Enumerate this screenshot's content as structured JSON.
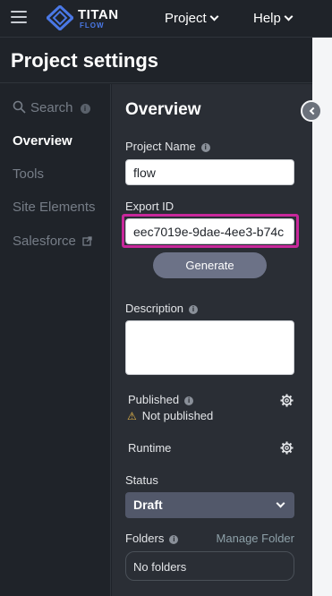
{
  "topbar": {
    "logo_text": "TITAN",
    "logo_sub": "FLOW",
    "nav": [
      {
        "label": "Project"
      },
      {
        "label": "Help"
      }
    ]
  },
  "header": {
    "title": "Project settings"
  },
  "leftnav": {
    "items": [
      {
        "label": "Search",
        "info": "i"
      },
      {
        "label": "Overview"
      },
      {
        "label": "Tools"
      },
      {
        "label": "Site Elements"
      },
      {
        "label": "Salesforce"
      }
    ]
  },
  "overview": {
    "heading": "Overview",
    "project_name": {
      "label": "Project Name",
      "info": "i",
      "value": "flow"
    },
    "export_id": {
      "label": "Export ID",
      "value": "eec7019e-9dae-4ee3-b74c"
    },
    "generate_label": "Generate",
    "description": {
      "label": "Description",
      "info": "i",
      "value": ""
    },
    "published": {
      "label": "Published",
      "info": "i",
      "status": "Not published",
      "warn_glyph": "⚠"
    },
    "runtime": {
      "label": "Runtime"
    },
    "status": {
      "label": "Status",
      "value": "Draft"
    },
    "folders": {
      "label": "Folders",
      "info": "i",
      "manage_label": "Manage Folder",
      "empty_text": "No folders"
    }
  },
  "colors": {
    "highlight": "#c8279b",
    "logo_blue": "#4a78e6",
    "panel_bg": "#2a2e35",
    "nav_bg": "#1f2329"
  }
}
